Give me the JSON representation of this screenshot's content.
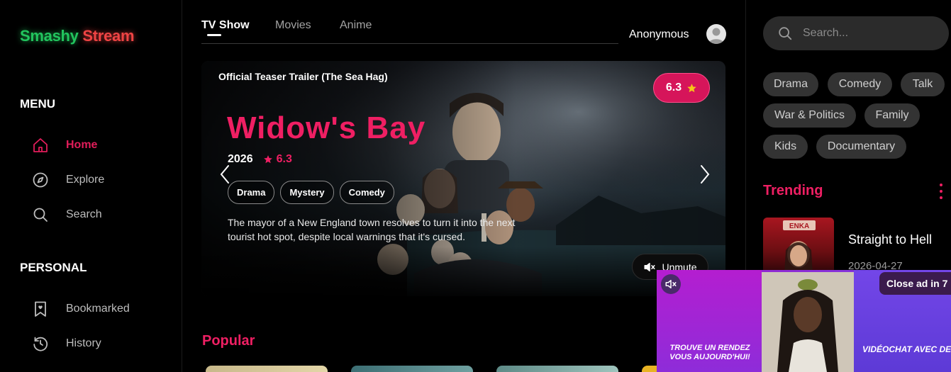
{
  "brand": {
    "part1": "Smashy",
    "part2": "Stream"
  },
  "menu": {
    "title": "MENU",
    "items": [
      {
        "label": "Home",
        "icon": "home-icon",
        "active": true
      },
      {
        "label": "Explore",
        "icon": "compass-icon"
      },
      {
        "label": "Search",
        "icon": "search-icon"
      }
    ]
  },
  "personal": {
    "title": "PERSONAL",
    "items": [
      {
        "label": "Bookmarked",
        "icon": "bookmark-icon"
      },
      {
        "label": "History",
        "icon": "history-icon"
      }
    ]
  },
  "tabs": [
    {
      "label": "TV Show",
      "active": true
    },
    {
      "label": "Movies"
    },
    {
      "label": "Anime"
    }
  ],
  "user": {
    "name": "Anonymous"
  },
  "hero": {
    "caption": "Official Teaser Trailer (The Sea Hag)",
    "title": "Widow's Bay",
    "year": "2026",
    "rating": "6.3",
    "score": "6.3",
    "genres": [
      "Drama",
      "Mystery",
      "Comedy"
    ],
    "description": "The mayor of a New England town resolves to turn it into the next tourist hot spot, despite local warnings that it's cursed.",
    "unmute_label": "Unmute"
  },
  "popular": {
    "title": "Popular"
  },
  "search": {
    "placeholder": "Search..."
  },
  "genre_filters": [
    "Drama",
    "Comedy",
    "Talk",
    "War & Politics",
    "Family",
    "Kids",
    "Documentary"
  ],
  "trending": {
    "title": "Trending",
    "items": [
      {
        "title": "Straight to Hell",
        "date": "2026-04-27",
        "poster_text": "ENKA"
      }
    ]
  },
  "ad": {
    "close_label": "Close ad in 7",
    "text_left": "Trouve un rendez vous aujourd'hui!",
    "text_right": "Vidéochat avec des beautés !"
  },
  "colors": {
    "accent": "#ef1f63",
    "brand_green": "#22c55e",
    "brand_red": "#ef4444"
  }
}
